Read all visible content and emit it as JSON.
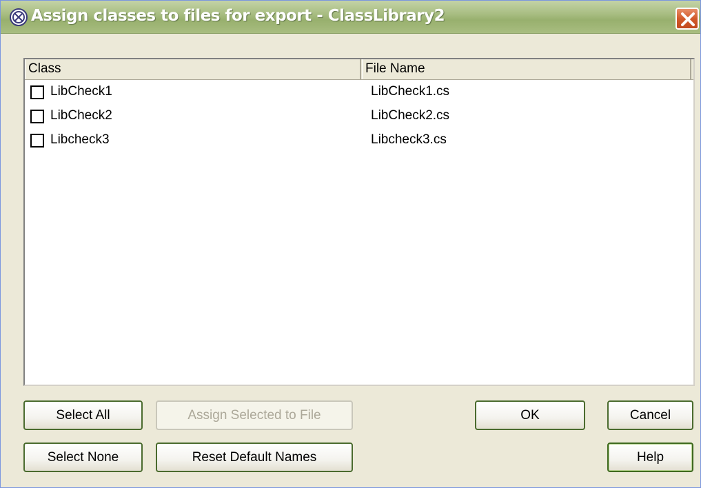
{
  "window": {
    "title": "Assign classes to files for export - ClassLibrary2",
    "app_icon": "class-diagram-icon",
    "close_icon": "close-icon"
  },
  "list": {
    "columns": {
      "class": "Class",
      "file_name": "File Name"
    },
    "rows": [
      {
        "class": "LibCheck1",
        "file_name": "LibCheck1.cs",
        "checked": false
      },
      {
        "class": "LibCheck2",
        "file_name": "LibCheck2.cs",
        "checked": false
      },
      {
        "class": "Libcheck3",
        "file_name": "Libcheck3.cs",
        "checked": false
      }
    ]
  },
  "buttons": {
    "select_all": "Select All",
    "assign_selected": "Assign Selected to File",
    "ok": "OK",
    "cancel": "Cancel",
    "select_none": "Select None",
    "reset_default_names": "Reset Default Names",
    "help": "Help"
  },
  "colors": {
    "titlebar": "#a9be83",
    "close_button": "#d25a2a",
    "dialog_background": "#ece9d8",
    "button_border": "#4a6b2e"
  }
}
